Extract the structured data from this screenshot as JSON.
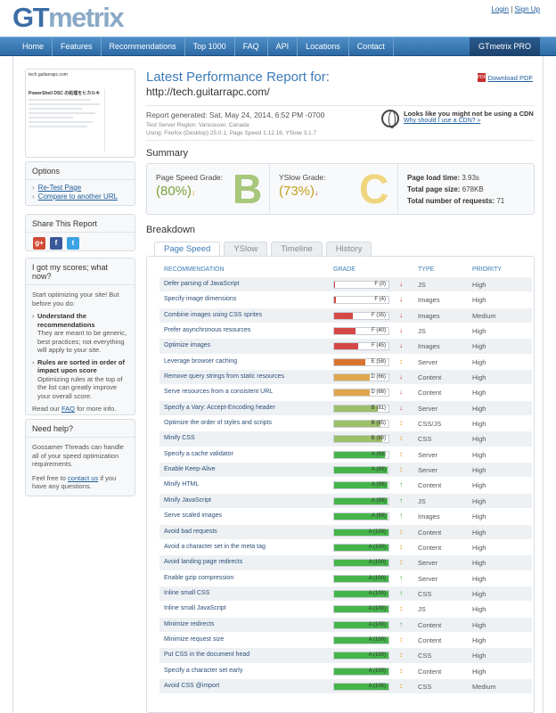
{
  "header": {
    "logo_gt": "GT",
    "logo_metrix": "metrix",
    "login": "Login",
    "sep": "|",
    "signup": "Sign Up"
  },
  "nav": {
    "items": [
      "Home",
      "Features",
      "Recommendations",
      "Top 1000",
      "FAQ",
      "API",
      "Locations",
      "Contact"
    ],
    "pro": "GTmetrix PRO"
  },
  "thumb": {
    "site": "tech.guitarrapc.com",
    "headline": "PowerShell DSC の処理をヒカルキ"
  },
  "options": {
    "title": "Options",
    "links": [
      "Re-Test Page",
      "Compare to another URL"
    ]
  },
  "share": {
    "title": "Share This Report",
    "icons": [
      "google-plus-icon",
      "facebook-icon",
      "twitter-icon"
    ],
    "glyphs": [
      "g+",
      "f",
      "t"
    ]
  },
  "help": {
    "title": "I got my scores; what now?",
    "intro": "Start optimizing your site! But before you do:",
    "b1_title": "Understand the recommendations",
    "b1_text": "They are meant to be generic, best practices; not everything will apply to your site.",
    "b2_title": "Rules are sorted in order of impact upon score",
    "b2_text": "Optimizing rules at the top of the list can greatly improve your overall score.",
    "faq_pre": "Read our",
    "faq_link": "FAQ",
    "faq_post": "for more info."
  },
  "need": {
    "title": "Need help?",
    "text": "Gossamer Threads can handle all of your speed optimization requirements.",
    "feel": "Feel free to",
    "contact": "contact us",
    "feel_post": "if you have any questions."
  },
  "report": {
    "title": "Latest Performance Report for:",
    "url": "http://tech.guitarrapc.com/",
    "pdf": "Download PDF",
    "generated": "Report generated: Sat, May 24, 2014, 6:52 PM -0700",
    "server": "Test Server Region:  Vancouver, Canada",
    "using": "Using: Firefox (Desktop) 25.0.1, Page Speed 1.12.16, YSlow 3.1.7",
    "cdn_title": "Looks like you might not be using a CDN",
    "cdn_link": "Why should I use a CDN? »"
  },
  "summary": {
    "title": "Summary",
    "ps_label": "Page Speed Grade:",
    "ps_pct": "(80%)",
    "ps_letter": "B",
    "ys_label": "YSlow Grade:",
    "ys_pct": "(73%)",
    "ys_letter": "C",
    "load_label": "Page load time:",
    "load_val": "3.93s",
    "size_label": "Total page size:",
    "size_val": "678KB",
    "req_label": "Total number of requests:",
    "req_val": "71"
  },
  "breakdown": {
    "title": "Breakdown",
    "tabs": [
      "Page Speed",
      "YSlow",
      "Timeline",
      "History"
    ],
    "headers": [
      "RECOMMENDATION",
      "GRADE",
      "TYPE",
      "PRIORITY"
    ],
    "rows": [
      {
        "name": "Defer parsing of JavaScript",
        "grade": "F (0)",
        "score": 0,
        "dir": "down",
        "type": "JS",
        "priority": "High"
      },
      {
        "name": "Specify image dimensions",
        "grade": "F (4)",
        "score": 4,
        "dir": "down",
        "type": "Images",
        "priority": "High"
      },
      {
        "name": "Combine images using CSS sprites",
        "grade": "F (35)",
        "score": 35,
        "dir": "down",
        "type": "Images",
        "priority": "Medium"
      },
      {
        "name": "Prefer asynchronous resources",
        "grade": "F (40)",
        "score": 40,
        "dir": "down",
        "type": "JS",
        "priority": "High"
      },
      {
        "name": "Optimize images",
        "grade": "F (45)",
        "score": 45,
        "dir": "down",
        "type": "Images",
        "priority": "High"
      },
      {
        "name": "Leverage browser caching",
        "grade": "E (58)",
        "score": 58,
        "dir": "side",
        "type": "Server",
        "priority": "High"
      },
      {
        "name": "Remove query strings from static resources",
        "grade": "D (66)",
        "score": 66,
        "dir": "down",
        "type": "Content",
        "priority": "High"
      },
      {
        "name": "Serve resources from a consistent URL",
        "grade": "D (66)",
        "score": 66,
        "dir": "down",
        "type": "Content",
        "priority": "High"
      },
      {
        "name": "Specify a Vary: Accept-Encoding header",
        "grade": "B (81)",
        "score": 81,
        "dir": "down",
        "type": "Server",
        "priority": "High"
      },
      {
        "name": "Optimize the order of styles and scripts",
        "grade": "B (85)",
        "score": 85,
        "dir": "side",
        "type": "CSS/JS",
        "priority": "High"
      },
      {
        "name": "Minify CSS",
        "grade": "B (89)",
        "score": 89,
        "dir": "side",
        "type": "CSS",
        "priority": "High"
      },
      {
        "name": "Specify a cache validator",
        "grade": "A (93)",
        "score": 93,
        "dir": "side",
        "type": "Server",
        "priority": "High"
      },
      {
        "name": "Enable Keep-Alive",
        "grade": "A (99)",
        "score": 99,
        "dir": "side",
        "type": "Server",
        "priority": "High"
      },
      {
        "name": "Minify HTML",
        "grade": "A (99)",
        "score": 99,
        "dir": "up",
        "type": "Content",
        "priority": "High"
      },
      {
        "name": "Minify JavaScript",
        "grade": "A (99)",
        "score": 99,
        "dir": "up",
        "type": "JS",
        "priority": "High"
      },
      {
        "name": "Serve scaled images",
        "grade": "A (99)",
        "score": 99,
        "dir": "up",
        "type": "Images",
        "priority": "High"
      },
      {
        "name": "Avoid bad requests",
        "grade": "A (100)",
        "score": 100,
        "dir": "side",
        "type": "Content",
        "priority": "High"
      },
      {
        "name": "Avoid a character set in the meta tag",
        "grade": "A (100)",
        "score": 100,
        "dir": "side",
        "type": "Content",
        "priority": "High"
      },
      {
        "name": "Avoid landing page redirects",
        "grade": "A (100)",
        "score": 100,
        "dir": "side",
        "type": "Server",
        "priority": "High"
      },
      {
        "name": "Enable gzip compression",
        "grade": "A (100)",
        "score": 100,
        "dir": "up",
        "type": "Server",
        "priority": "High"
      },
      {
        "name": "Inline small CSS",
        "grade": "A (100)",
        "score": 100,
        "dir": "up",
        "type": "CSS",
        "priority": "High"
      },
      {
        "name": "Inline small JavaScript",
        "grade": "A (100)",
        "score": 100,
        "dir": "side",
        "type": "JS",
        "priority": "High"
      },
      {
        "name": "Minimize redirects",
        "grade": "A (100)",
        "score": 100,
        "dir": "up",
        "type": "Content",
        "priority": "High"
      },
      {
        "name": "Minimize request size",
        "grade": "A (100)",
        "score": 100,
        "dir": "side",
        "type": "Content",
        "priority": "High"
      },
      {
        "name": "Put CSS in the document head",
        "grade": "A (100)",
        "score": 100,
        "dir": "side",
        "type": "CSS",
        "priority": "High"
      },
      {
        "name": "Specify a character set early",
        "grade": "A (100)",
        "score": 100,
        "dir": "side",
        "type": "Content",
        "priority": "High"
      },
      {
        "name": "Avoid CSS @import",
        "grade": "A (100)",
        "score": 100,
        "dir": "side",
        "type": "CSS",
        "priority": "Medium"
      }
    ]
  },
  "colors": {
    "F": "#d54848",
    "E": "#d9742e",
    "D": "#e0a64e",
    "B": "#9cbf6a",
    "A": "#45b54a",
    "arrow_down": "#c0392b",
    "arrow_up": "#3fa33f",
    "arrow_side": "#e09a1a"
  }
}
